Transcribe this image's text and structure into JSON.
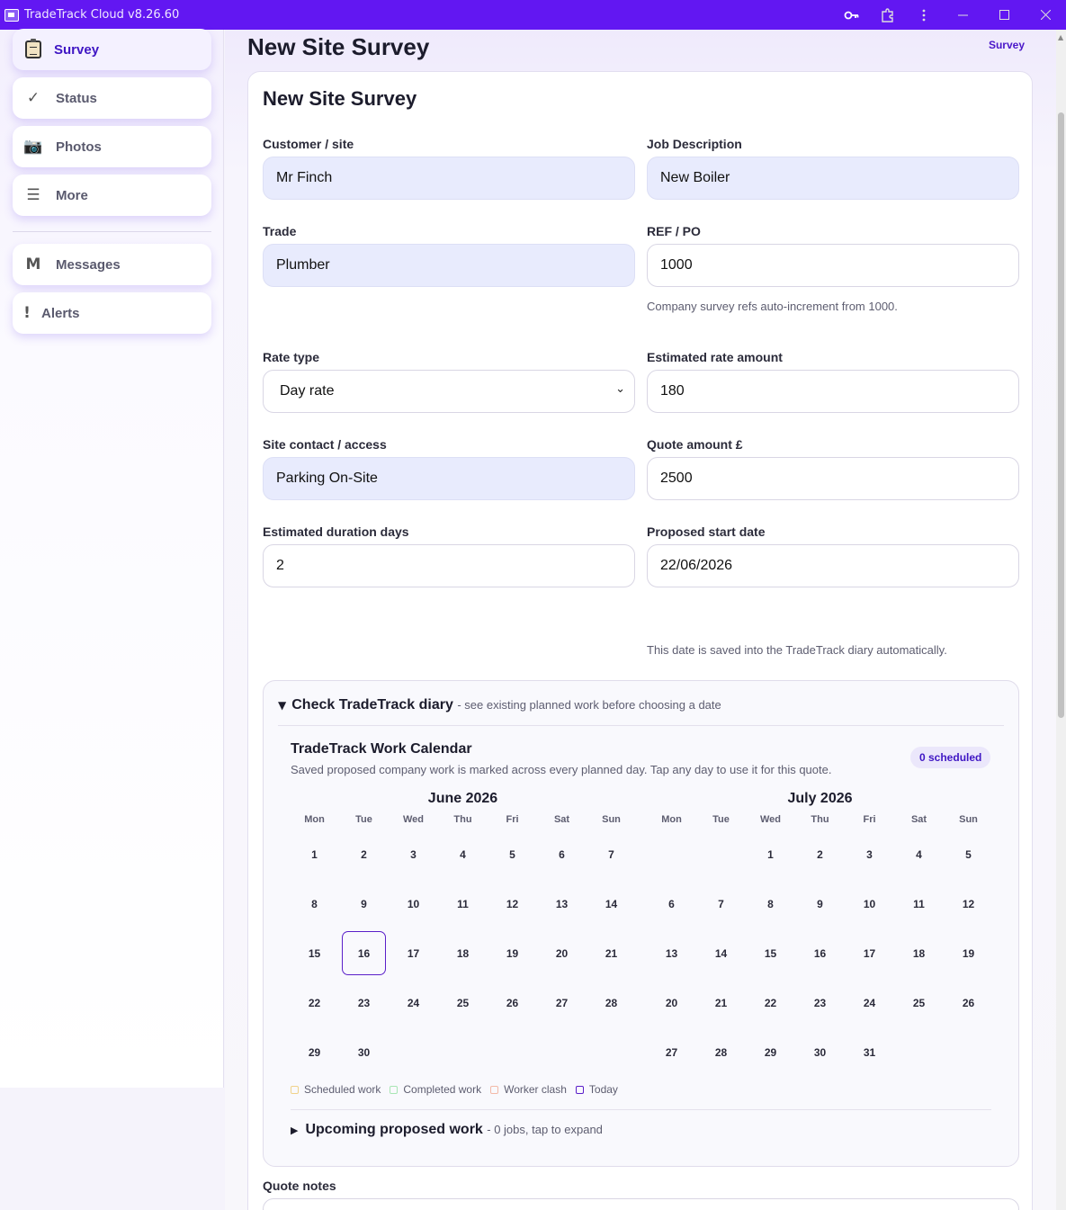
{
  "window": {
    "title": "TradeTrack Cloud v8.26.60"
  },
  "sidebar": {
    "items": [
      {
        "label": "Survey",
        "icon": "clipboard-icon"
      },
      {
        "label": "Status",
        "icon": "checkmark-icon",
        "glyph": "✓"
      },
      {
        "label": "Photos",
        "icon": "camera-icon",
        "glyph": "📷"
      },
      {
        "label": "More",
        "icon": "menu-icon",
        "glyph": "☰"
      },
      {
        "label": "Messages",
        "icon": "messages-icon",
        "glyph": "M"
      },
      {
        "label": "Alerts",
        "icon": "alert-icon",
        "glyph": "!"
      }
    ]
  },
  "header": {
    "title": "New Site Survey",
    "breadcrumb": "Survey"
  },
  "form": {
    "title": "New Site Survey",
    "customer": {
      "label": "Customer / site",
      "value": "Mr Finch"
    },
    "job": {
      "label": "Job Description",
      "value": "New Boiler"
    },
    "trade": {
      "label": "Trade",
      "value": "Plumber"
    },
    "ref": {
      "label": "REF / PO",
      "value": "1000",
      "help": "Company survey refs auto-increment from 1000."
    },
    "rate_type": {
      "label": "Rate type",
      "value": "Day rate"
    },
    "rate_amount": {
      "label": "Estimated rate amount",
      "value": "180"
    },
    "contact": {
      "label": "Site contact / access",
      "value": "Parking On-Site"
    },
    "quote": {
      "label": "Quote amount £",
      "value": "2500"
    },
    "duration": {
      "label": "Estimated duration days",
      "value": "2"
    },
    "start_date": {
      "label": "Proposed start date",
      "value": "22/06/2026",
      "help": "This date is saved into the TradeTrack diary automatically."
    },
    "notes": {
      "label": "Quote notes"
    }
  },
  "diary": {
    "heading": "Check TradeTrack diary",
    "heading_sub": "- see existing planned work before choosing a date",
    "calendar_title": "TradeTrack Work Calendar",
    "calendar_sub": "Saved proposed company work is marked across every planned day. Tap any day to use it for this quote.",
    "badge": "0 scheduled",
    "weekdays": [
      "Mon",
      "Tue",
      "Wed",
      "Thu",
      "Fri",
      "Sat",
      "Sun"
    ],
    "months": [
      {
        "name": "June 2026",
        "offset": 0,
        "days": 30,
        "today": 16
      },
      {
        "name": "July 2026",
        "offset": 2,
        "days": 31,
        "today": null
      }
    ],
    "legend": [
      {
        "label": "Scheduled work",
        "color": "#f0d28a"
      },
      {
        "label": "Completed work",
        "color": "#a8e6b4"
      },
      {
        "label": "Worker clash",
        "color": "#f3b9a8"
      },
      {
        "label": "Today",
        "color": "#5a1fc9"
      }
    ],
    "upcoming": "Upcoming proposed work",
    "upcoming_sub": "- 0 jobs, tap to expand"
  },
  "colors": {
    "titlebar": "#6217f2",
    "accent": "#3f16c4"
  }
}
